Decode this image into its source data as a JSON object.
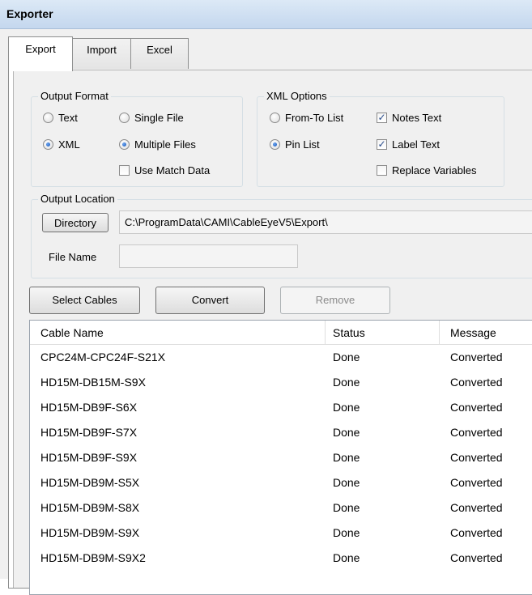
{
  "window": {
    "title": "Exporter"
  },
  "tabs": [
    {
      "label": "Export",
      "active": true
    },
    {
      "label": "Import",
      "active": false
    },
    {
      "label": "Excel",
      "active": false
    }
  ],
  "output_format": {
    "legend": "Output Format",
    "text_label": "Text",
    "single_file_label": "Single File",
    "xml_label": "XML",
    "multiple_files_label": "Multiple Files",
    "use_match_data_label": "Use Match Data",
    "selected_format": "XML",
    "selected_files": "Multiple Files",
    "use_match_data": false
  },
  "xml_options": {
    "legend": "XML Options",
    "from_to_label": "From-To List",
    "pin_list_label": "Pin List",
    "notes_text_label": "Notes Text",
    "label_text_label": "Label Text",
    "replace_variables_label": "Replace Variables",
    "selected_list": "Pin List",
    "notes_text": true,
    "label_text": true,
    "replace_variables": false
  },
  "output_location": {
    "legend": "Output Location",
    "directory_button": "Directory",
    "directory_path": "C:\\ProgramData\\CAMI\\CableEyeV5\\Export\\",
    "file_name_label": "File Name",
    "file_name_value": ""
  },
  "actions": {
    "select_cables": "Select Cables",
    "convert": "Convert",
    "remove": "Remove"
  },
  "table": {
    "columns": [
      "Cable Name",
      "Status",
      "Message"
    ],
    "rows": [
      [
        "CPC24M-CPC24F-S21X",
        "Done",
        "Converted"
      ],
      [
        "HD15M-DB15M-S9X",
        "Done",
        "Converted"
      ],
      [
        "HD15M-DB9F-S6X",
        "Done",
        "Converted"
      ],
      [
        "HD15M-DB9F-S7X",
        "Done",
        "Converted"
      ],
      [
        "HD15M-DB9F-S9X",
        "Done",
        "Converted"
      ],
      [
        "HD15M-DB9M-S5X",
        "Done",
        "Converted"
      ],
      [
        "HD15M-DB9M-S8X",
        "Done",
        "Converted"
      ],
      [
        "HD15M-DB9M-S9X",
        "Done",
        "Converted"
      ],
      [
        "HD15M-DB9M-S9X2",
        "Done",
        "Converted"
      ]
    ]
  }
}
